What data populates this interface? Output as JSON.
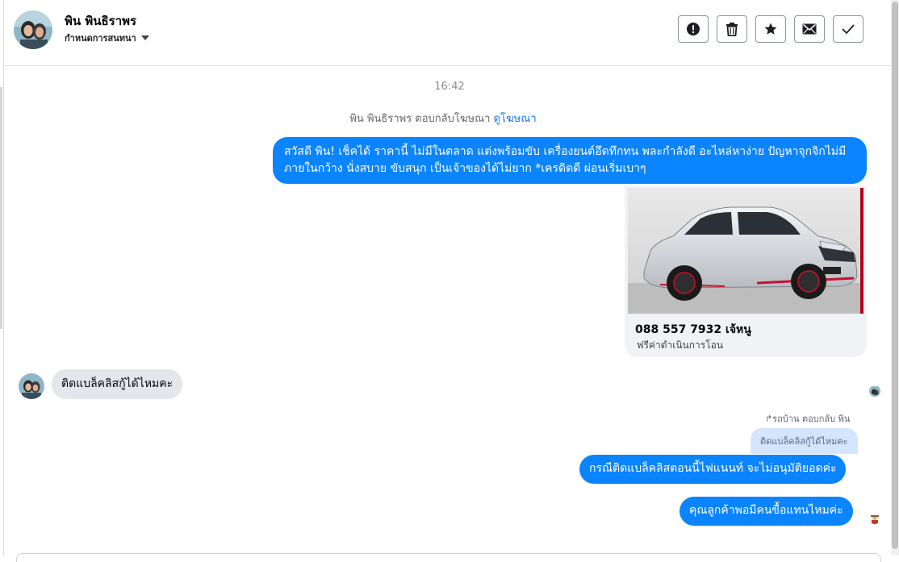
{
  "header": {
    "contact_name": "พิน พินธิราพร",
    "status_label": "กำหนดการสนทนา",
    "actions": [
      {
        "name": "report",
        "icon": "exclamation-icon"
      },
      {
        "name": "delete",
        "icon": "trash-icon"
      },
      {
        "name": "star",
        "icon": "star-icon"
      },
      {
        "name": "unread",
        "icon": "envelope-icon"
      },
      {
        "name": "done",
        "icon": "check-icon"
      }
    ]
  },
  "thread": {
    "timestamp": "16:42",
    "ad_reply_note": "พิน พินธิราพร ตอบกลับโฆษณา",
    "ad_link": "ดูโฆษณา",
    "messages": {
      "outgoing_1": "สวัสดี พิน! เช็คได้ ราคานี้ ไม่มีในตลาด แต่งพร้อมขับ เครื่องยนต์อึดทึกทน พละกำลังดี อะไหล่หาง่าย ปัญหาจุกจิกไม่มี ภายในกว้าง นั่งสบาย ขับสนุก เป็นเจ้าของได้ไม่ยาก *เครดิตดี ผ่อนเริ่มเบาๆ",
      "incoming_1": "ติดแบล็คลิสกู้ได้ไหมคะ",
      "reply_label": "รถบ้าน ตอบกลับ พิน",
      "quoted": "ติดแบล็คลิสกู้ได้ไหมคะ",
      "outgoing_2": "กรณีติดแบล็คลิสตอนนี้ไฟแนนท์ จะไม่อนุมัติยอดค่ะ",
      "outgoing_3": "คุณลูกค้าพอมีคนขื้อแทนไหมค่ะ"
    },
    "ad_card": {
      "title": "088 557 7932 เจ้หนู",
      "subtitle": "ฟรีค่าดำเนินการโอน"
    }
  },
  "colors": {
    "outgoing_bubble": "#0a84ff",
    "incoming_bubble": "#e4e6eb",
    "link": "#1877f2"
  }
}
